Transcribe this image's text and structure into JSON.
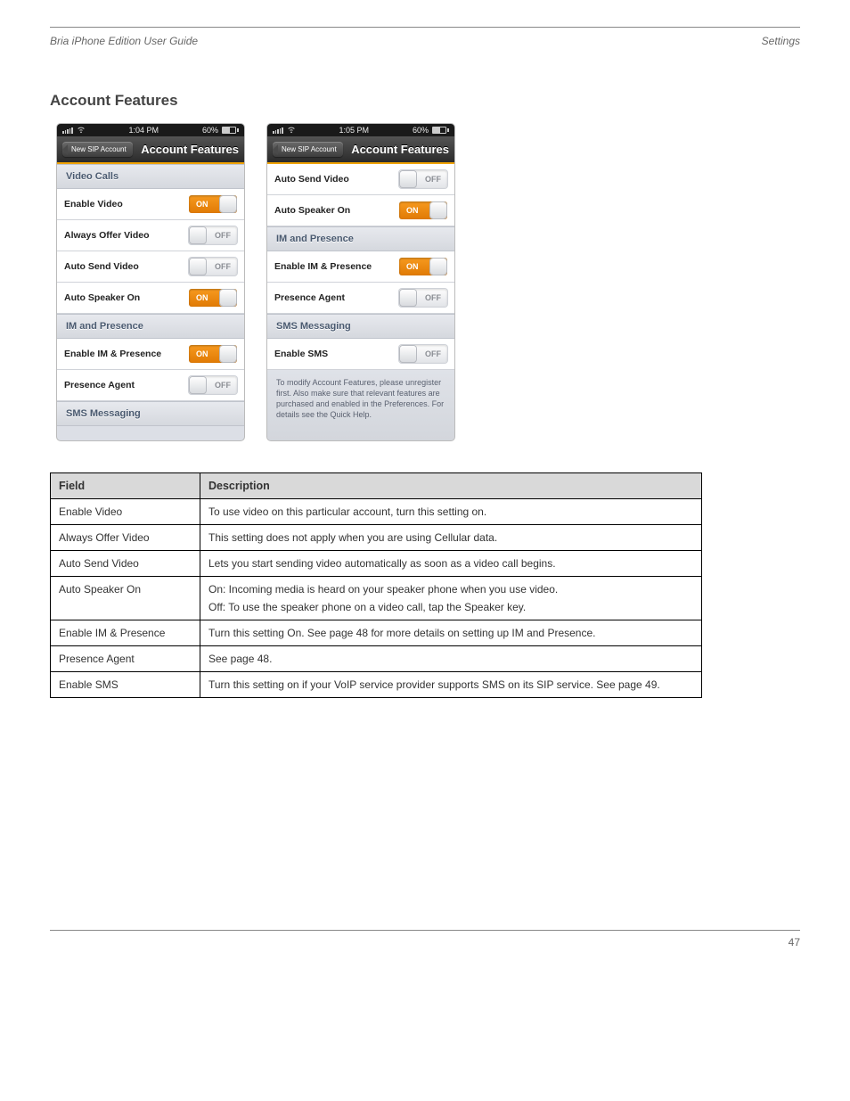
{
  "header": {
    "left": "Bria iPhone Edition User Guide",
    "right": "Settings"
  },
  "section_title": "Account Features",
  "table": {
    "headers": [
      "Field",
      "Description"
    ],
    "rows": [
      [
        "Enable Video",
        "To use video on this particular account, turn this setting on."
      ],
      [
        "Always Offer Video",
        "This setting does not apply when you are using Cellular data."
      ],
      [
        "Auto Send Video",
        "Lets you start sending video automatically as soon as a video call begins."
      ],
      [
        "Auto Speaker On",
        "On: Incoming media is heard on your speaker phone when you use video.\nOff: To use the speaker phone on a video call, tap the Speaker key."
      ],
      [
        "Enable IM & Presence",
        "Turn this setting On. See page 48 for more details on setting up IM and Presence."
      ],
      [
        "Presence Agent",
        "See page 48."
      ],
      [
        "Enable SMS",
        "Turn this setting on if your VoIP service provider supports SMS on its SIP service. See page 49."
      ]
    ]
  },
  "phone_left": {
    "status": {
      "time": "1:04 PM",
      "battery": "60%"
    },
    "back": "New SIP Account",
    "title": "Account Features",
    "sections": [
      {
        "header": "Video Calls",
        "rows": [
          {
            "label": "Enable Video",
            "toggle": "ON"
          },
          {
            "label": "Always Offer Video",
            "toggle": "OFF"
          },
          {
            "label": "Auto Send Video",
            "toggle": "OFF"
          },
          {
            "label": "Auto Speaker On",
            "toggle": "ON"
          }
        ]
      },
      {
        "header": "IM and Presence",
        "rows": [
          {
            "label": "Enable IM & Presence",
            "toggle": "ON"
          },
          {
            "label": "Presence Agent",
            "toggle": "OFF"
          }
        ]
      },
      {
        "header": "SMS Messaging",
        "rows": []
      }
    ]
  },
  "phone_right": {
    "status": {
      "time": "1:05 PM",
      "battery": "60%"
    },
    "back": "New SIP Account",
    "title": "Account Features",
    "sections": [
      {
        "header": null,
        "rows": [
          {
            "label": "Auto Send Video",
            "toggle": "OFF"
          },
          {
            "label": "Auto Speaker On",
            "toggle": "ON"
          }
        ]
      },
      {
        "header": "IM and Presence",
        "rows": [
          {
            "label": "Enable IM & Presence",
            "toggle": "ON"
          },
          {
            "label": "Presence Agent",
            "toggle": "OFF"
          }
        ]
      },
      {
        "header": "SMS Messaging",
        "rows": [
          {
            "label": "Enable SMS",
            "toggle": "OFF"
          }
        ]
      }
    ],
    "help": "To modify Account Features, please unregister first. Also make sure that relevant features are purchased and enabled in the Preferences. For details see the Quick Help."
  },
  "toggle_labels": {
    "on": "ON",
    "off": "OFF"
  },
  "footer": {
    "page": "47"
  }
}
